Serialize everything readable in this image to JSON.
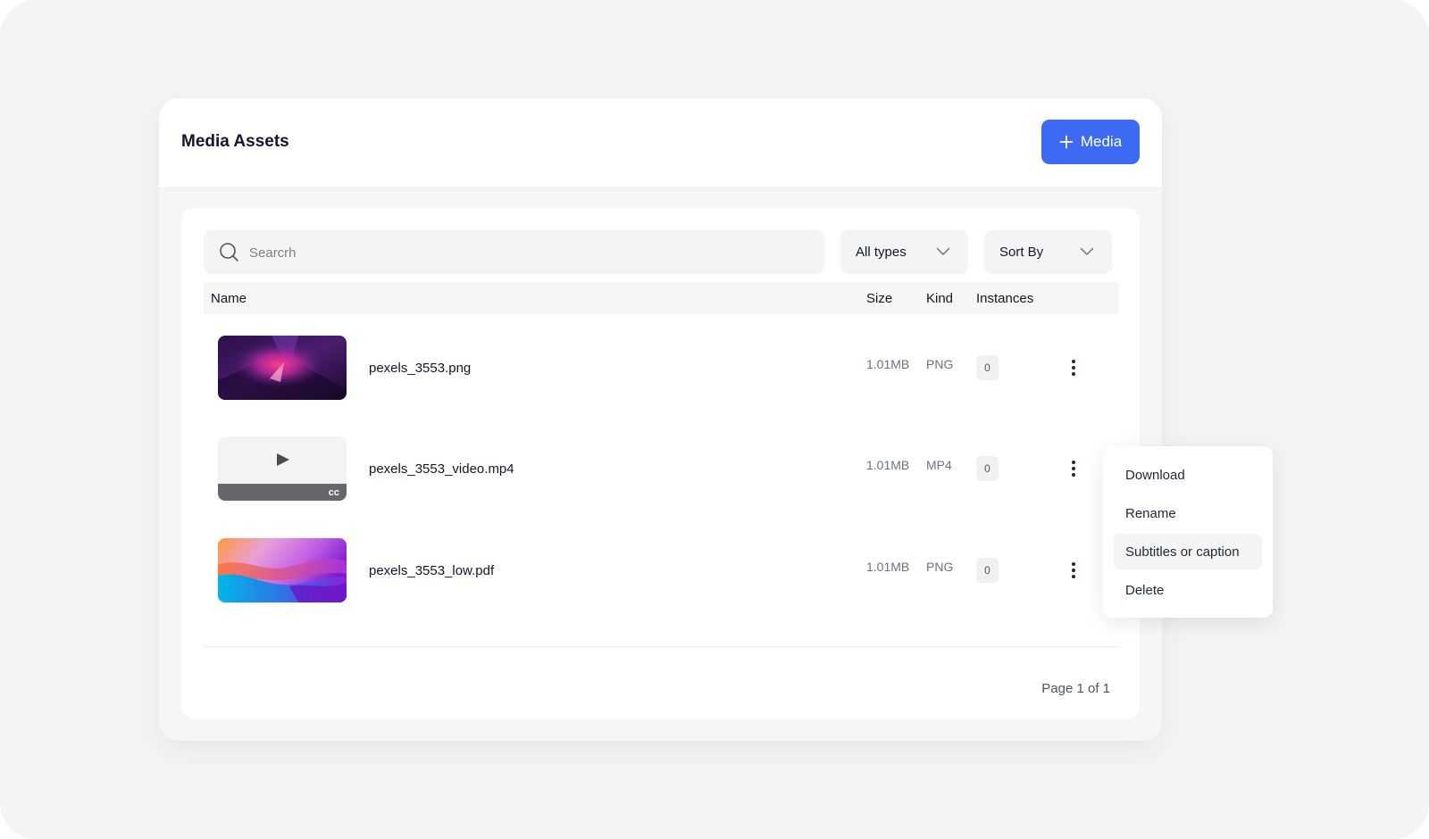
{
  "header": {
    "title": "Media Assets",
    "add_button_label": "Media"
  },
  "toolbar": {
    "search_placeholder": "Searcrh",
    "type_filter": "All types",
    "sort_label": "Sort By"
  },
  "table": {
    "columns": {
      "name": "Name",
      "size": "Size",
      "kind": "Kind",
      "instances": "Instances"
    },
    "rows": [
      {
        "name": "pexels_3553.png",
        "size": "1.01MB",
        "kind": "PNG",
        "instances": "0"
      },
      {
        "name": "pexels_3553_video.mp4",
        "size": "1.01MB",
        "kind": "MP4",
        "instances": "0",
        "caption_badge": "cc"
      },
      {
        "name": "pexels_3553_low.pdf",
        "size": "1.01MB",
        "kind": "PNG",
        "instances": "0"
      }
    ]
  },
  "pagination": {
    "label": "Page 1 of 1"
  },
  "context_menu": {
    "items": [
      "Download",
      "Rename",
      "Subtitles or caption",
      "Delete"
    ],
    "active_item": "Subtitles or caption"
  },
  "colors": {
    "accent": "#3d6af2",
    "background": "#f4f4f5",
    "card": "#ffffff"
  },
  "icons": {
    "plus": "plus-icon",
    "search": "search-icon",
    "chevron": "chevron-down-icon",
    "more": "more-vertical-icon",
    "play": "play-icon"
  }
}
